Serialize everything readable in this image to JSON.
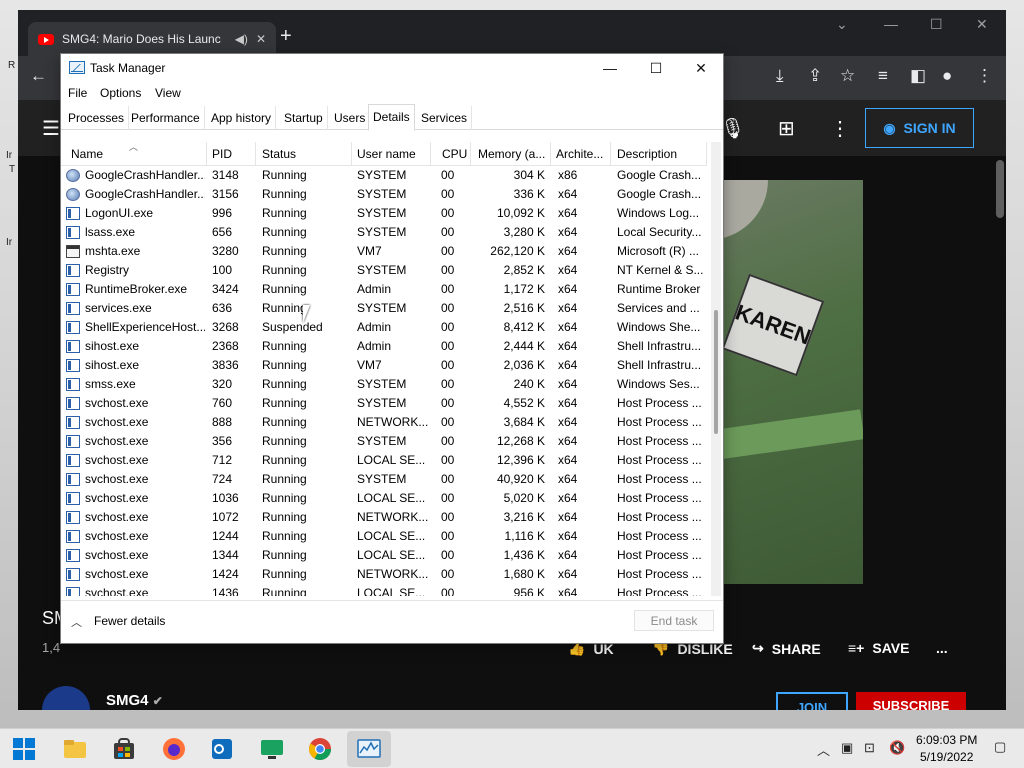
{
  "desktop": {
    "fragments": [
      "R",
      "Ir",
      "T",
      "Ir"
    ]
  },
  "browser": {
    "tab_title": "SMG4: Mario Does His Launc",
    "tab_audio_icon": "speaker-icon",
    "new_tab_symbol": "+",
    "sign_in_label": "SIGN IN"
  },
  "youtube": {
    "video_badge_text": "KAREN",
    "video_title": "SM",
    "views_text": "1,4",
    "actions": {
      "like_partial": "UK",
      "dislike_partial": "DISLIKE",
      "share": "SHARE",
      "save": "SAVE",
      "more": "..."
    },
    "channel_name": "SMG4",
    "join_label": "JOIN",
    "subscribe_label": "SUBSCRIBE"
  },
  "taskmgr": {
    "title": "Task Manager",
    "menu": [
      "File",
      "Options",
      "View"
    ],
    "tabs": [
      "Processes",
      "Performance",
      "App history",
      "Startup",
      "Users",
      "Details",
      "Services"
    ],
    "active_tab": "Details",
    "columns": [
      "Name",
      "PID",
      "Status",
      "User name",
      "CPU",
      "Memory (a...",
      "Archite...",
      "Description"
    ],
    "rows": [
      {
        "icon": "globe",
        "name": "GoogleCrashHandler...",
        "pid": "3148",
        "status": "Running",
        "user": "SYSTEM",
        "cpu": "00",
        "mem": "304 K",
        "arch": "x86",
        "desc": "Google Crash..."
      },
      {
        "icon": "globe",
        "name": "GoogleCrashHandler...",
        "pid": "3156",
        "status": "Running",
        "user": "SYSTEM",
        "cpu": "00",
        "mem": "336 K",
        "arch": "x64",
        "desc": "Google Crash..."
      },
      {
        "icon": "app",
        "name": "LogonUI.exe",
        "pid": "996",
        "status": "Running",
        "user": "SYSTEM",
        "cpu": "00",
        "mem": "10,092 K",
        "arch": "x64",
        "desc": "Windows Log..."
      },
      {
        "icon": "app",
        "name": "lsass.exe",
        "pid": "656",
        "status": "Running",
        "user": "SYSTEM",
        "cpu": "00",
        "mem": "3,280 K",
        "arch": "x64",
        "desc": "Local Security..."
      },
      {
        "icon": "win",
        "name": "mshta.exe",
        "pid": "3280",
        "status": "Running",
        "user": "VM7",
        "cpu": "00",
        "mem": "262,120 K",
        "arch": "x64",
        "desc": "Microsoft (R) ..."
      },
      {
        "icon": "app",
        "name": "Registry",
        "pid": "100",
        "status": "Running",
        "user": "SYSTEM",
        "cpu": "00",
        "mem": "2,852 K",
        "arch": "x64",
        "desc": "NT Kernel & S..."
      },
      {
        "icon": "app",
        "name": "RuntimeBroker.exe",
        "pid": "3424",
        "status": "Running",
        "user": "Admin",
        "cpu": "00",
        "mem": "1,172 K",
        "arch": "x64",
        "desc": "Runtime Broker"
      },
      {
        "icon": "app",
        "name": "services.exe",
        "pid": "636",
        "status": "Running",
        "user": "SYSTEM",
        "cpu": "00",
        "mem": "2,516 K",
        "arch": "x64",
        "desc": "Services and ..."
      },
      {
        "icon": "app",
        "name": "ShellExperienceHost....",
        "pid": "3268",
        "status": "Suspended",
        "user": "Admin",
        "cpu": "00",
        "mem": "8,412 K",
        "arch": "x64",
        "desc": "Windows She..."
      },
      {
        "icon": "app",
        "name": "sihost.exe",
        "pid": "2368",
        "status": "Running",
        "user": "Admin",
        "cpu": "00",
        "mem": "2,444 K",
        "arch": "x64",
        "desc": "Shell Infrastru..."
      },
      {
        "icon": "app",
        "name": "sihost.exe",
        "pid": "3836",
        "status": "Running",
        "user": "VM7",
        "cpu": "00",
        "mem": "2,036 K",
        "arch": "x64",
        "desc": "Shell Infrastru..."
      },
      {
        "icon": "app",
        "name": "smss.exe",
        "pid": "320",
        "status": "Running",
        "user": "SYSTEM",
        "cpu": "00",
        "mem": "240 K",
        "arch": "x64",
        "desc": "Windows Ses..."
      },
      {
        "icon": "app",
        "name": "svchost.exe",
        "pid": "760",
        "status": "Running",
        "user": "SYSTEM",
        "cpu": "00",
        "mem": "4,552 K",
        "arch": "x64",
        "desc": "Host Process ..."
      },
      {
        "icon": "app",
        "name": "svchost.exe",
        "pid": "888",
        "status": "Running",
        "user": "NETWORK...",
        "cpu": "00",
        "mem": "3,684 K",
        "arch": "x64",
        "desc": "Host Process ..."
      },
      {
        "icon": "app",
        "name": "svchost.exe",
        "pid": "356",
        "status": "Running",
        "user": "SYSTEM",
        "cpu": "00",
        "mem": "12,268 K",
        "arch": "x64",
        "desc": "Host Process ..."
      },
      {
        "icon": "app",
        "name": "svchost.exe",
        "pid": "712",
        "status": "Running",
        "user": "LOCAL SE...",
        "cpu": "00",
        "mem": "12,396 K",
        "arch": "x64",
        "desc": "Host Process ..."
      },
      {
        "icon": "app",
        "name": "svchost.exe",
        "pid": "724",
        "status": "Running",
        "user": "SYSTEM",
        "cpu": "00",
        "mem": "40,920 K",
        "arch": "x64",
        "desc": "Host Process ..."
      },
      {
        "icon": "app",
        "name": "svchost.exe",
        "pid": "1036",
        "status": "Running",
        "user": "LOCAL SE...",
        "cpu": "00",
        "mem": "5,020 K",
        "arch": "x64",
        "desc": "Host Process ..."
      },
      {
        "icon": "app",
        "name": "svchost.exe",
        "pid": "1072",
        "status": "Running",
        "user": "NETWORK...",
        "cpu": "00",
        "mem": "3,216 K",
        "arch": "x64",
        "desc": "Host Process ..."
      },
      {
        "icon": "app",
        "name": "svchost.exe",
        "pid": "1244",
        "status": "Running",
        "user": "LOCAL SE...",
        "cpu": "00",
        "mem": "1,116 K",
        "arch": "x64",
        "desc": "Host Process ..."
      },
      {
        "icon": "app",
        "name": "svchost.exe",
        "pid": "1344",
        "status": "Running",
        "user": "LOCAL SE...",
        "cpu": "00",
        "mem": "1,436 K",
        "arch": "x64",
        "desc": "Host Process ..."
      },
      {
        "icon": "app",
        "name": "svchost.exe",
        "pid": "1424",
        "status": "Running",
        "user": "NETWORK...",
        "cpu": "00",
        "mem": "1,680 K",
        "arch": "x64",
        "desc": "Host Process ..."
      },
      {
        "icon": "app",
        "name": "svchost.exe",
        "pid": "1436",
        "status": "Running",
        "user": "LOCAL SE...",
        "cpu": "00",
        "mem": "956 K",
        "arch": "x64",
        "desc": "Host Process ..."
      }
    ],
    "fewer_details": "Fewer details",
    "end_task": "End task"
  },
  "taskbar": {
    "apps": [
      "windows-start-icon",
      "file-explorer-icon",
      "microsoft-store-icon",
      "firefox-icon",
      "outlook-icon",
      "remote-desktop-icon",
      "chrome-icon",
      "task-manager-icon"
    ],
    "time": "6:09:03 PM",
    "date": "5/19/2022"
  },
  "colors": {
    "accent": "#0067c0",
    "youtube_red": "#ff0000",
    "signin_blue": "#3ea6ff"
  }
}
